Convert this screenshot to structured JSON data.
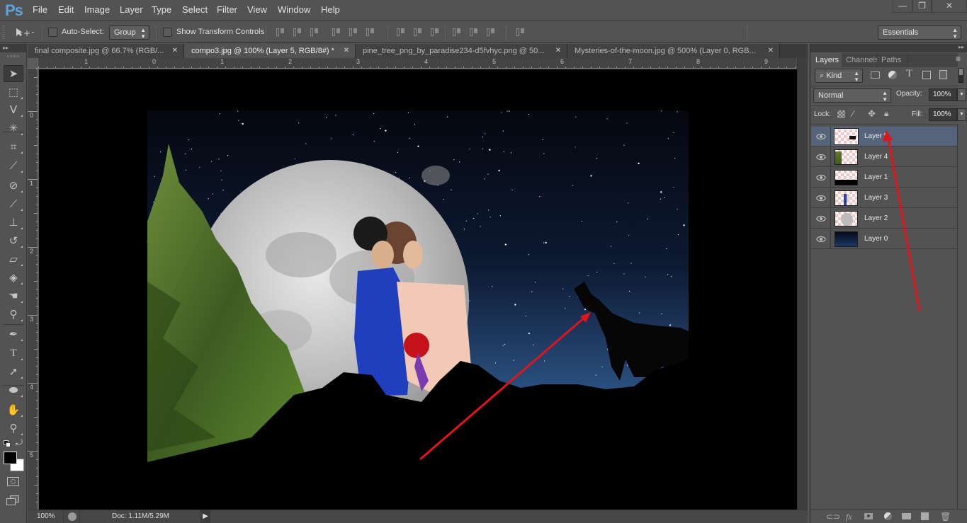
{
  "app": {
    "logo": "Ps",
    "menu": [
      "File",
      "Edit",
      "Image",
      "Layer",
      "Type",
      "Select",
      "Filter",
      "View",
      "Window",
      "Help"
    ],
    "window_controls": {
      "minimize": "—",
      "restore": "❐",
      "close": "✕"
    }
  },
  "options_bar": {
    "auto_select_label": "Auto-Select:",
    "auto_select_checked": false,
    "auto_select_mode": "Group",
    "show_transform_label": "Show Transform Controls",
    "show_transform_checked": false,
    "workspace": "Essentials"
  },
  "tools": [
    {
      "name": "move-tool",
      "icon": "move-icon",
      "active": true
    },
    {
      "name": "marquee-tool",
      "icon": "rect-marquee-icon"
    },
    {
      "name": "lasso-tool",
      "icon": "polygonal-lasso-icon"
    },
    {
      "name": "magic-wand-tool",
      "icon": "magic-wand-icon"
    },
    {
      "name": "crop-tool",
      "icon": "crop-icon"
    },
    {
      "name": "eyedropper-tool",
      "icon": "eyedropper-icon"
    },
    {
      "name": "healing-brush-tool",
      "icon": "bandage-icon"
    },
    {
      "name": "brush-tool",
      "icon": "brush-icon"
    },
    {
      "name": "clone-stamp-tool",
      "icon": "stamp-icon"
    },
    {
      "name": "history-brush-tool",
      "icon": "history-brush-icon"
    },
    {
      "name": "eraser-tool",
      "icon": "eraser-icon"
    },
    {
      "name": "paint-bucket-tool",
      "icon": "bucket-icon"
    },
    {
      "name": "smudge-tool",
      "icon": "smudge-icon"
    },
    {
      "name": "dodge-tool",
      "icon": "dodge-icon"
    },
    {
      "name": "pen-tool",
      "icon": "pen-icon"
    },
    {
      "name": "type-tool",
      "icon": "type-icon"
    },
    {
      "name": "path-selection-tool",
      "icon": "arrow-icon"
    },
    {
      "name": "ellipse-tool",
      "icon": "ellipse-icon"
    },
    {
      "name": "hand-tool",
      "icon": "hand-icon"
    },
    {
      "name": "zoom-tool",
      "icon": "zoom-icon"
    }
  ],
  "colors": {
    "foreground": "#000000",
    "background": "#ffffff",
    "accent_selected_row": "#56647b",
    "arrow_annotation": "#e0141a"
  },
  "document_tabs": [
    {
      "label": "final composite.jpg @ 66.7% (RGB/...",
      "active": false
    },
    {
      "label": "compo3.jpg @ 100% (Layer 5, RGB/8#) *",
      "active": true
    },
    {
      "label": "pine_tree_png_by_paradise234-d5fvhyc.png @ 50...",
      "active": false
    },
    {
      "label": "Mysteries-of-the-moon.jpg @ 500% (Layer 0, RGB...",
      "active": false
    }
  ],
  "rulers": {
    "top": [
      "1",
      "0",
      "1",
      "2",
      "3",
      "4",
      "5",
      "6",
      "7",
      "8",
      "9"
    ],
    "left": [
      "0",
      "1",
      "2",
      "3",
      "4",
      "5"
    ]
  },
  "status": {
    "zoom": "100%",
    "doc_size": "Doc: 1.11M/5.29M"
  },
  "layers_panel": {
    "tabs": [
      "Layers",
      "Channels",
      "Paths"
    ],
    "active_tab": "Layers",
    "filter_kind": "Kind",
    "blend_mode": "Normal",
    "opacity_label": "Opacity:",
    "opacity": "100%",
    "lock_label": "Lock:",
    "fill_label": "Fill:",
    "fill": "100%",
    "layers": [
      {
        "name": "Layer 5",
        "visible": true,
        "selected": true,
        "thumb": "wolf"
      },
      {
        "name": "Layer 4",
        "visible": true,
        "selected": false,
        "thumb": "tree"
      },
      {
        "name": "Layer 1",
        "visible": true,
        "selected": false,
        "thumb": "mountains"
      },
      {
        "name": "Layer 3",
        "visible": true,
        "selected": false,
        "thumb": "couple"
      },
      {
        "name": "Layer 2",
        "visible": true,
        "selected": false,
        "thumb": "moon"
      },
      {
        "name": "Layer 0",
        "visible": true,
        "selected": false,
        "thumb": "sky"
      }
    ],
    "footer_icons": [
      "link-icon",
      "fx-icon",
      "mask-icon",
      "adjustment-icon",
      "folder-icon",
      "new-layer-icon",
      "trash-icon"
    ]
  }
}
